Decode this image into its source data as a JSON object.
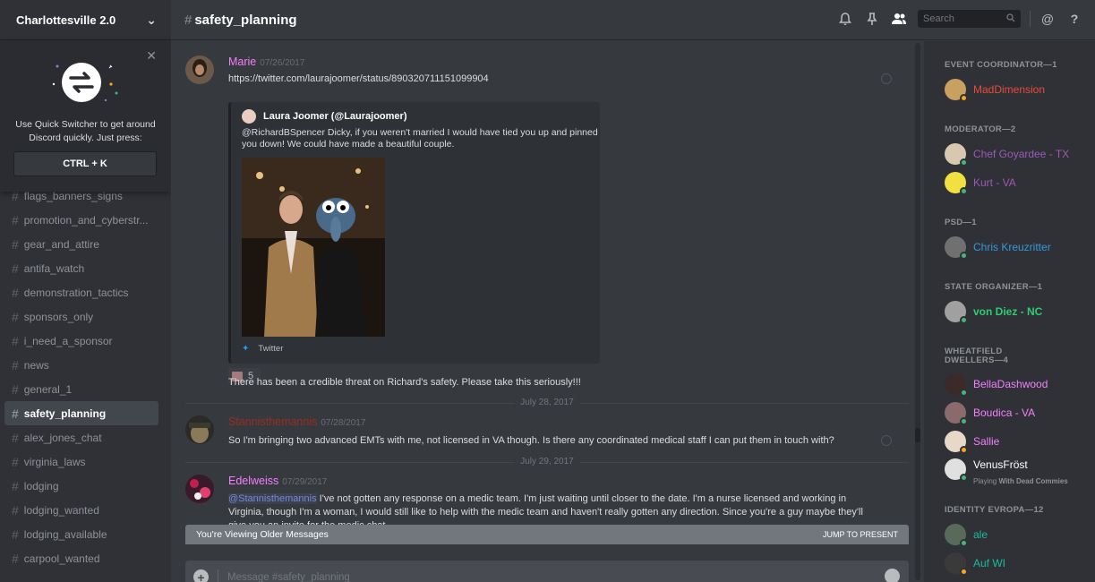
{
  "server": {
    "name": "Charlottesville 2.0"
  },
  "quick_switcher": {
    "text_line1": "Use Quick Switcher to get around",
    "text_line2": "Discord quickly. Just press:",
    "shortcut": "CTRL + K"
  },
  "channels": [
    {
      "name": "flags_banners_signs"
    },
    {
      "name": "promotion_and_cyberstr..."
    },
    {
      "name": "gear_and_attire"
    },
    {
      "name": "antifa_watch"
    },
    {
      "name": "demonstration_tactics"
    },
    {
      "name": "sponsors_only"
    },
    {
      "name": "i_need_a_sponsor"
    },
    {
      "name": "news"
    },
    {
      "name": "general_1"
    },
    {
      "name": "safety_planning",
      "active": true
    },
    {
      "name": "alex_jones_chat"
    },
    {
      "name": "virginia_laws"
    },
    {
      "name": "lodging"
    },
    {
      "name": "lodging_wanted"
    },
    {
      "name": "lodging_available"
    },
    {
      "name": "carpool_wanted"
    }
  ],
  "header": {
    "channel": "safety_planning",
    "hash": "#",
    "search_placeholder": "Search"
  },
  "messages": {
    "m1": {
      "author": "Marie",
      "author_color": "#f47fff",
      "time": "07/26/2017",
      "link": "https://twitter.com/laurajoomer/status/890320711151099904",
      "embed": {
        "author": "Laura Joomer (@Laurajoomer)",
        "description": "@RichardBSpencer Dicky, if you weren't married I would have tied you up and pinned you down! We could have made a beautiful couple.",
        "footer": "Twitter"
      },
      "reaction_count": "5",
      "text": "There has been a credible threat on Richard's safety. Please take this seriously!!!"
    },
    "divider1": "July 28, 2017",
    "m2": {
      "author": "Stannisthemannis",
      "author_color": "#992d22",
      "time": "07/28/2017",
      "text": "So I'm bringing two advanced EMTs with me, not licensed in VA though.  Is there any coordinated medical staff I can put them in touch with?"
    },
    "divider2": "July 29, 2017",
    "m3": {
      "author": "Edelweiss",
      "author_color": "#f47fff",
      "time": "07/29/2017",
      "mention": "@Stannisthemannis",
      "line1": " I've not gotten any response on a medic team. I'm just waiting until closer to the date. I'm a nurse licensed and working in",
      "line2": "Virginia, though I'm a woman, I would still like to help with the medic team and haven't really gotten any direction. Since you're a guy maybe they'll",
      "line3": "give you an invite for the medic chat."
    }
  },
  "older_bar": {
    "label": "You're Viewing Older Messages",
    "jump": "JUMP TO PRESENT"
  },
  "composer": {
    "placeholder": "Message #safety_planning"
  },
  "members": {
    "roles": [
      {
        "title": "EVENT COORDINATOR—1"
      },
      {
        "title": "MODERATOR—2"
      },
      {
        "title": "PSD—1"
      },
      {
        "title": "STATE ORGANIZER—1"
      },
      {
        "title": "WHEATFIELD DWELLERS—4"
      },
      {
        "title": "IDENTITY EVROPA—12"
      }
    ],
    "list": [
      {
        "name": "MadDimension",
        "color": "#e74c3c",
        "status": "idle"
      },
      {
        "name": "Chef Goyardee - TX",
        "color": "#9b59b6",
        "status": "on"
      },
      {
        "name": "Kurt - VA",
        "color": "#9b59b6",
        "status": "on"
      },
      {
        "name": "Chris Kreuzritter",
        "color": "#3498db",
        "status": "on"
      },
      {
        "name": "von Diez - NC",
        "color": "#2ecc71",
        "status": "on"
      },
      {
        "name": "BellaDashwood",
        "color": "#f47fff",
        "status": "on"
      },
      {
        "name": "Boudica - VA",
        "color": "#f47fff",
        "status": "on"
      },
      {
        "name": "Sallie",
        "color": "#f47fff",
        "status": "idle"
      },
      {
        "name": "VenusFröst",
        "color": "#ffffff",
        "status": "on",
        "sub_prefix": "Playing ",
        "sub_game": "With Dead Commies"
      },
      {
        "name": "ale",
        "color": "#1abc9c",
        "status": "on"
      },
      {
        "name": "Auf WI",
        "color": "#1abc9c",
        "status": "idle"
      }
    ]
  }
}
